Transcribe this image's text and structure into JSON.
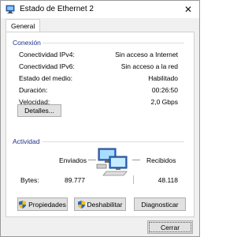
{
  "window": {
    "title": "Estado de Ethernet 2"
  },
  "tabs": [
    {
      "label": "General"
    }
  ],
  "connection": {
    "title": "Conexión",
    "rows": [
      {
        "label": "Conectividad IPv4:",
        "value": "Sin acceso a Internet"
      },
      {
        "label": "Conectividad IPv6:",
        "value": "Sin acceso a la red"
      },
      {
        "label": "Estado del medio:",
        "value": "Habilitado"
      },
      {
        "label": "Duración:",
        "value": "00:26:50"
      },
      {
        "label": "Velocidad:",
        "value": "2,0 Gbps"
      }
    ],
    "details_button": "Detalles..."
  },
  "activity": {
    "title": "Actividad",
    "sent_label": "Enviados",
    "received_label": "Recibidos",
    "bytes_label": "Bytes:",
    "bytes_sent": "89.777",
    "bytes_received": "48.118"
  },
  "actions": {
    "properties": "Propiedades",
    "disable": "Deshabilitar",
    "diagnose": "Diagnosticar"
  },
  "footer": {
    "close": "Cerrar"
  },
  "colors": {
    "group_title": "#1e3287",
    "button_bg": "#e1e1e1",
    "window_bg": "#f0f0f0"
  }
}
